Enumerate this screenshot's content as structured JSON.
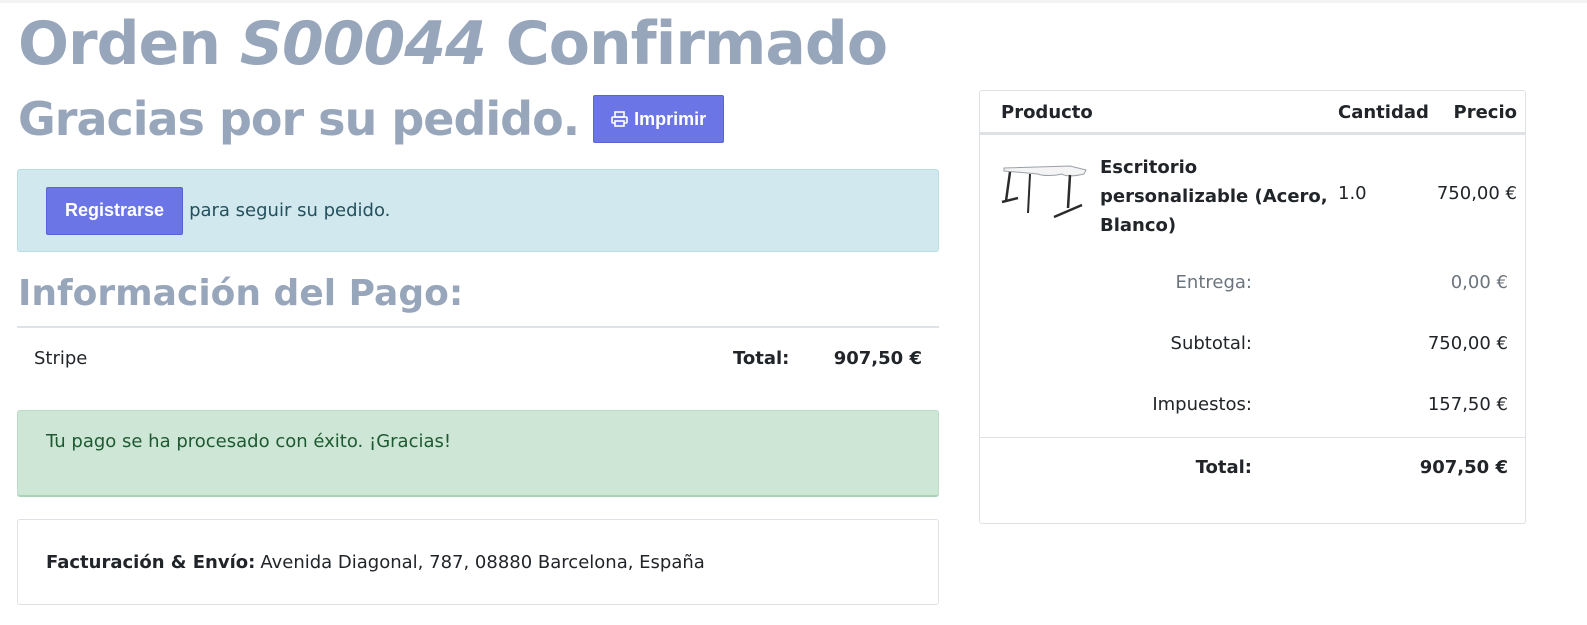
{
  "header": {
    "title_prefix": "Orden",
    "order_number": "S00044",
    "title_suffix": "Confirmado",
    "thanks": "Gracias por su pedido.",
    "print_label": "Imprimir"
  },
  "signup_alert": {
    "register_label": "Registrarse",
    "text": "para seguir su pedido."
  },
  "payment": {
    "heading": "Información del Pago:",
    "method": "Stripe",
    "total_label": "Total:",
    "total_value": "907,50 €",
    "success_message": "Tu pago se ha procesado con éxito. ¡Gracias!"
  },
  "address": {
    "label": "Facturación & Envío:",
    "value": "Avenida Diagonal, 787, 08880 Barcelona, España"
  },
  "summary": {
    "columns": {
      "product": "Producto",
      "quantity": "Cantidad",
      "price": "Precio"
    },
    "item": {
      "name": "Escritorio personalizable (Acero, Blanco)",
      "quantity": "1.0",
      "price": "750,00 €"
    },
    "delivery_label": "Entrega:",
    "delivery_value": "0,00 €",
    "subtotal_label": "Subtotal:",
    "subtotal_value": "750,00 €",
    "taxes_label": "Impuestos:",
    "taxes_value": "157,50 €",
    "total_label": "Total:",
    "total_value": "907,50 €"
  },
  "colors": {
    "accent": "#6c75e6",
    "heading": "#98a6bb",
    "info_bg": "#d1e9ee",
    "success_bg": "#cde6d5"
  }
}
